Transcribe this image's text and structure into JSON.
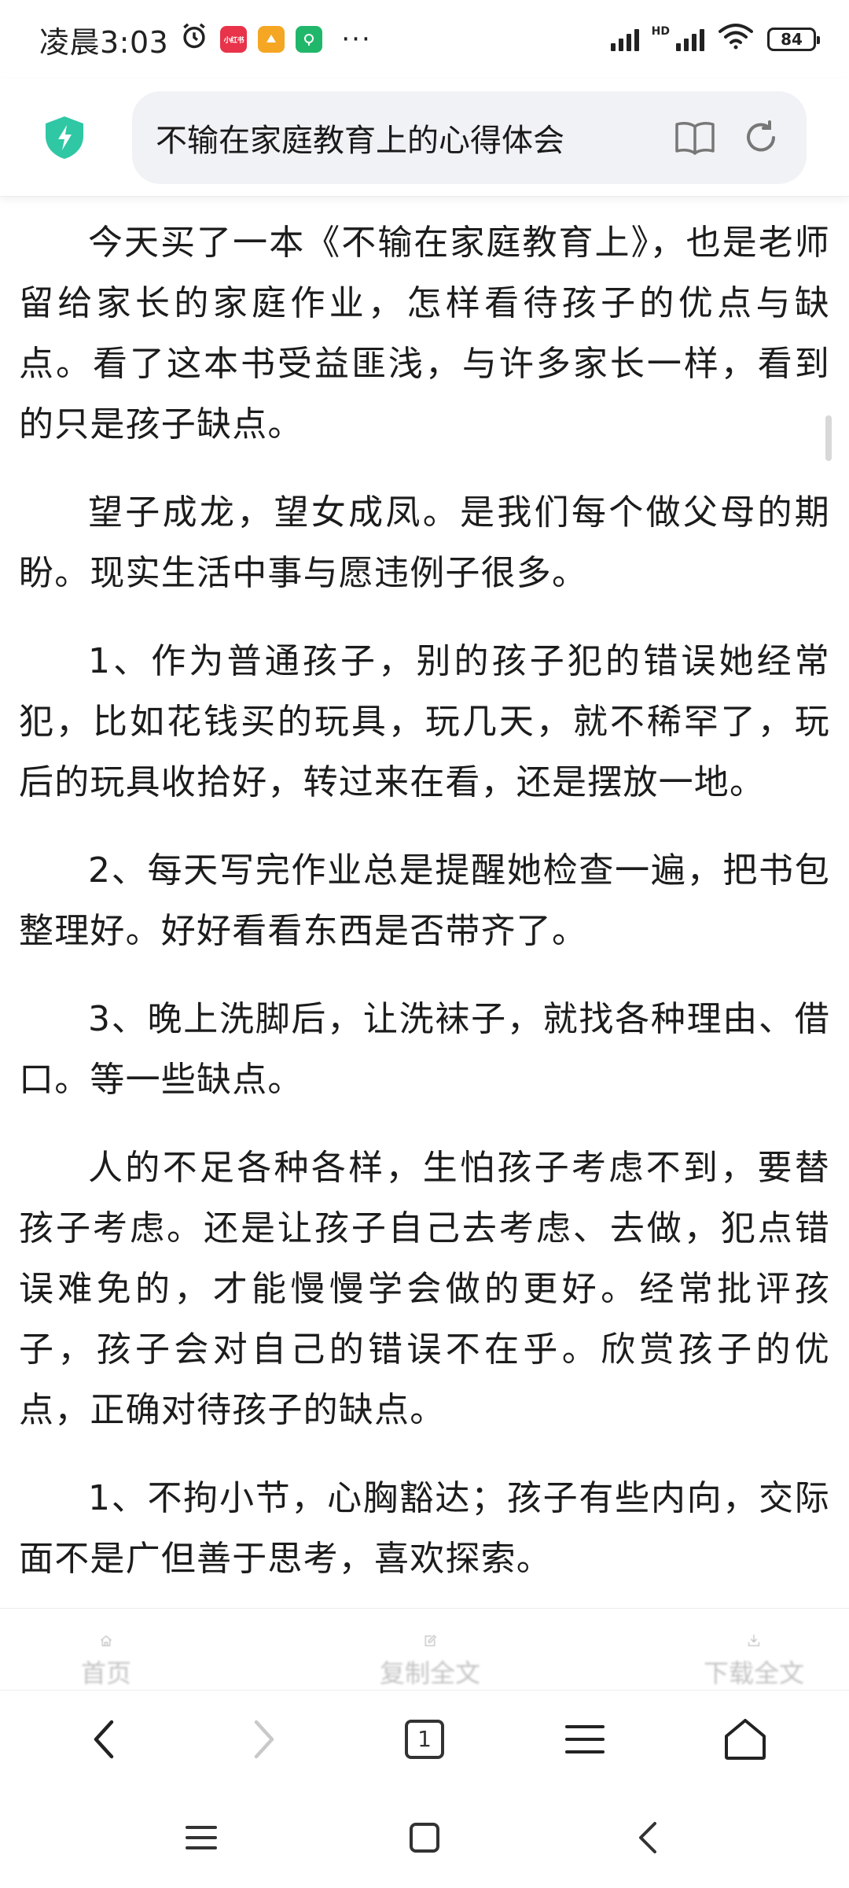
{
  "status_bar": {
    "time": "凌晨3:03",
    "dots": "···",
    "hd": "HD",
    "battery": "84",
    "app_icons": [
      {
        "name": "alarm-icon"
      },
      {
        "name": "xiaohongshu-app-icon",
        "label": "小红书",
        "color": "#e8334a"
      },
      {
        "name": "orange-app-icon",
        "color": "#f5a623"
      },
      {
        "name": "green-app-icon",
        "color": "#21b76b"
      }
    ]
  },
  "url_bar": {
    "title": "不输在家庭教育上的心得体会",
    "shield_color": "#2fc7a4"
  },
  "article": {
    "paragraphs": [
      "今天买了一本《不输在家庭教育上》，也是老师留给家长的家庭作业，怎样看待孩子的优点与缺点。看了这本书受益匪浅，与许多家长一样，看到的只是孩子缺点。",
      "望子成龙，望女成凤。是我们每个做父母的期盼。现实生活中事与愿违例子很多。",
      "1、作为普通孩子，别的孩子犯的错误她经常犯，比如花钱买的玩具，玩几天，就不稀罕了，玩后的玩具收拾好，转过来在看，还是摆放一地。",
      "2、每天写完作业总是提醒她检查一遍，把书包整理好。好好看看东西是否带齐了。",
      "3、晚上洗脚后，让洗袜子，就找各种理由、借口。等一些缺点。",
      "人的不足各种各样，生怕孩子考虑不到，要替孩子考虑。还是让孩子自己去考虑、去做，犯点错误难免的，才能慢慢学会做的更好。经常批评孩子，孩子会对自己的错误不在乎。欣赏孩子的优点，正确对待孩子的缺点。",
      "1、不拘小节，心胸豁达；孩子有些内向，交际面不是广但善于思考，喜欢探索。"
    ]
  },
  "share_strip": {
    "items": [
      {
        "label": "首页",
        "icon": "home-icon"
      },
      {
        "label": "复制全文",
        "icon": "edit-icon"
      },
      {
        "label": "下载全文",
        "icon": "download-icon"
      }
    ]
  },
  "browser_nav": {
    "tab_count": "1",
    "buttons": [
      "back-icon",
      "forward-icon",
      "tabs-icon",
      "menu-icon",
      "home-icon"
    ]
  },
  "system_nav": {
    "buttons": [
      "recents-icon",
      "home-icon",
      "back-icon"
    ]
  }
}
